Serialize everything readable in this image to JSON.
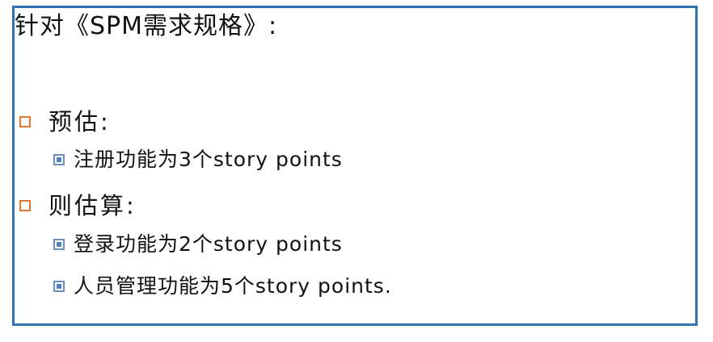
{
  "slide": {
    "title": "针对《SPM需求规格》:",
    "items": [
      {
        "label": "预估:",
        "subitems": [
          "注册功能为3个story points"
        ]
      },
      {
        "label": "则估算:",
        "subitems": [
          "登录功能为2个story points",
          "人员管理功能为5个story points."
        ]
      }
    ]
  },
  "colors": {
    "frame_border": "#2e74b5",
    "level1_bullet": "#e0773a",
    "level2_bullet": "#4f81bd"
  }
}
